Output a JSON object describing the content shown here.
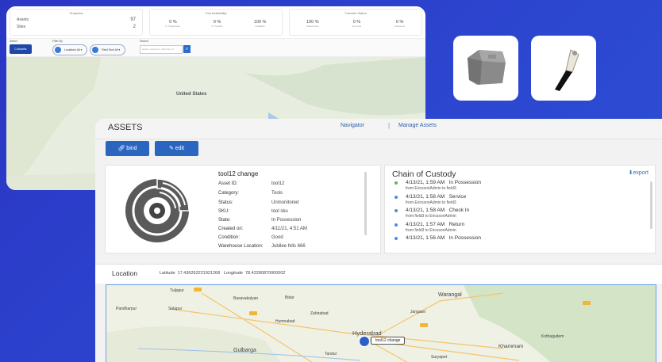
{
  "dashboard": {
    "snapshot": {
      "title": "Snapshot",
      "assets_label": "Assets",
      "assets_count": "97",
      "sites_label": "Sites",
      "sites_count": "2"
    },
    "availability": {
      "title": "Tool Availability",
      "items": [
        {
          "value": "0 %",
          "label": "In Possession"
        },
        {
          "value": "0 %",
          "label": "In Transfer"
        },
        {
          "value": "100 %",
          "label": "Available"
        }
      ]
    },
    "transfer": {
      "title": "Transfer Status",
      "items": [
        {
          "value": "100 %",
          "label": "Warehouse"
        },
        {
          "value": "0 %",
          "label": "En-route"
        },
        {
          "value": "0 %",
          "label": "Delivered"
        }
      ]
    },
    "filters": {
      "select_label": "Select",
      "select_value": "0",
      "select_sub": "Assets",
      "filter_by_label": "Filter By",
      "location_label": "Locations",
      "location_sub": "All",
      "field_label": "Field Tech",
      "field_sub": "All",
      "search_label": "Search",
      "search_placeholder": "assets, locations, channels, id"
    },
    "map_label": "United States"
  },
  "asset_page": {
    "title": "ASSETS",
    "nav": {
      "navigator": "Navigator",
      "separator": "|",
      "manage": "Manage Assets"
    },
    "buttons": {
      "bind": "bind",
      "edit": "edit"
    },
    "asset": {
      "name": "tool12 change",
      "fields": [
        {
          "k": "Asset ID:",
          "v": "tool12"
        },
        {
          "k": "Category:",
          "v": "Tools"
        },
        {
          "k": "Status:",
          "v": "Unmonitored"
        },
        {
          "k": "SKU:",
          "v": "tool sku"
        },
        {
          "k": "State:",
          "v": "In Possession"
        },
        {
          "k": "Created on:",
          "v": "4/11/21, 4:51 AM"
        },
        {
          "k": "Condition:",
          "v": "Good"
        },
        {
          "k": "Warehouse Location:",
          "v": "Jubilee hills 666"
        }
      ]
    },
    "custody": {
      "title": "Chain of Custody",
      "export": "export",
      "events": [
        {
          "time": "4/13/21, 1:59 AM",
          "action": "In Possession",
          "detail": "from EricssonAdmin to field3",
          "color": "#5cb85c"
        },
        {
          "time": "4/13/21, 1:58 AM",
          "action": "Service",
          "detail": "from EricssonAdmin to field3",
          "color": "#4a8de0"
        },
        {
          "time": "4/13/21, 1:58 AM",
          "action": "Check In",
          "detail": "from field3 to EricssonAdmin",
          "color": "#4a8de0"
        },
        {
          "time": "4/13/21, 1:57 AM",
          "action": "Return",
          "detail": "from field3 to EricssonAdmin",
          "color": "#4a8de0"
        },
        {
          "time": "4/13/21, 1:56 AM",
          "action": "In Possession",
          "detail": "",
          "color": "#4a8de0"
        }
      ]
    },
    "location": {
      "title": "Location",
      "lat_label": "Latitude",
      "lat": "17.436262221921268",
      "lng_label": "Longitude",
      "lng": "78.42280870000002",
      "marker_label": "tool12 change"
    },
    "map_cities": {
      "hyderabad": "Hyderabad",
      "warangal": "Warangal",
      "solapur": "Solapur",
      "basavakalyan": "Basavakalyan",
      "bidar": "Bidar",
      "gulbarga": "Gulbarga",
      "khammam": "Khammam",
      "kothagudem": "Kothagudem",
      "pandharpur": "Pandharpur",
      "suryapet": "Suryapet",
      "tandur": "Tandur",
      "jangaon": "Jangaon",
      "tuljapur": "Tuljapur",
      "zahirabad": "Zahirabad",
      "humnabad": "Humnabad"
    }
  }
}
